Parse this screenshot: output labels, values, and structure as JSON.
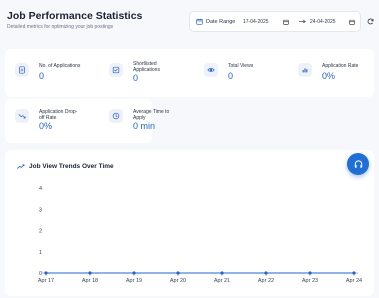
{
  "header": {
    "title": "Job Performance Statistics",
    "subtitle": "Detailed metrics for optimizing your job postings"
  },
  "date_range": {
    "label": "Date Range",
    "start": "17-04-2025",
    "end": "24-04-2025"
  },
  "stats": [
    {
      "label_lines": [
        "No. of Applications"
      ],
      "value": "0",
      "icon": "document-icon"
    },
    {
      "label_lines": [
        "Shortlisted",
        "Applications"
      ],
      "value": "0",
      "icon": "checklist-icon"
    },
    {
      "label_lines": [
        "Total Views"
      ],
      "value": "0",
      "icon": "eye-icon"
    },
    {
      "label_lines": [
        "Application Rate"
      ],
      "value": "0%",
      "icon": "bar-chart-icon"
    },
    {
      "label_lines": [
        "Application Drop-",
        "off Rate"
      ],
      "value": "0%",
      "icon": "trend-down-icon"
    },
    {
      "label_lines": [
        "Average Time to",
        "Apply"
      ],
      "value": "0 min",
      "icon": "clock-icon"
    }
  ],
  "chart_title": "Job View Trends Over Time",
  "chart_data": {
    "type": "line",
    "title": "Job View Trends Over Time",
    "categories": [
      "Apr 17",
      "Apr 18",
      "Apr 19",
      "Apr 20",
      "Apr 21",
      "Apr 22",
      "Apr 23",
      "Apr 24"
    ],
    "values": [
      0,
      0,
      0,
      0,
      0,
      0,
      0,
      0
    ],
    "y_ticks": [
      "0",
      "1",
      "2",
      "3",
      "4"
    ],
    "ylim": [
      0,
      4
    ],
    "grid": false,
    "color": "#2563c9"
  },
  "colors": {
    "accent": "#2563c9",
    "fab": "#1f6fd6"
  }
}
